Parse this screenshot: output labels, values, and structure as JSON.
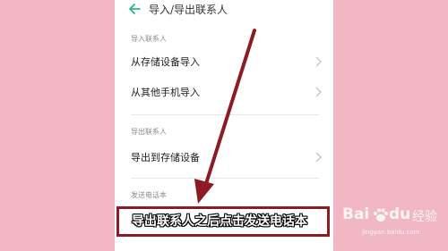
{
  "header": {
    "title": "导入/导出联系人",
    "back_icon": "back-arrow-icon"
  },
  "sections": [
    {
      "label": "导入联系人",
      "items": [
        {
          "label": "从存储设备导入"
        },
        {
          "label": "从其他手机导入"
        }
      ]
    },
    {
      "label": "导出联系人",
      "items": [
        {
          "label": "导出到存储设备"
        }
      ]
    },
    {
      "label": "发送电话本",
      "items": []
    }
  ],
  "annotation": {
    "caption": "导出联系人之后点击发送电话本"
  },
  "watermark": {
    "brand": "Bai",
    "brand_suffix": "du",
    "sub": "经验",
    "url": "jingyan.baidu.com"
  },
  "colors": {
    "background": "#f2b7c4",
    "accent": "#2bb38e",
    "arrow": "#8b1c24"
  }
}
